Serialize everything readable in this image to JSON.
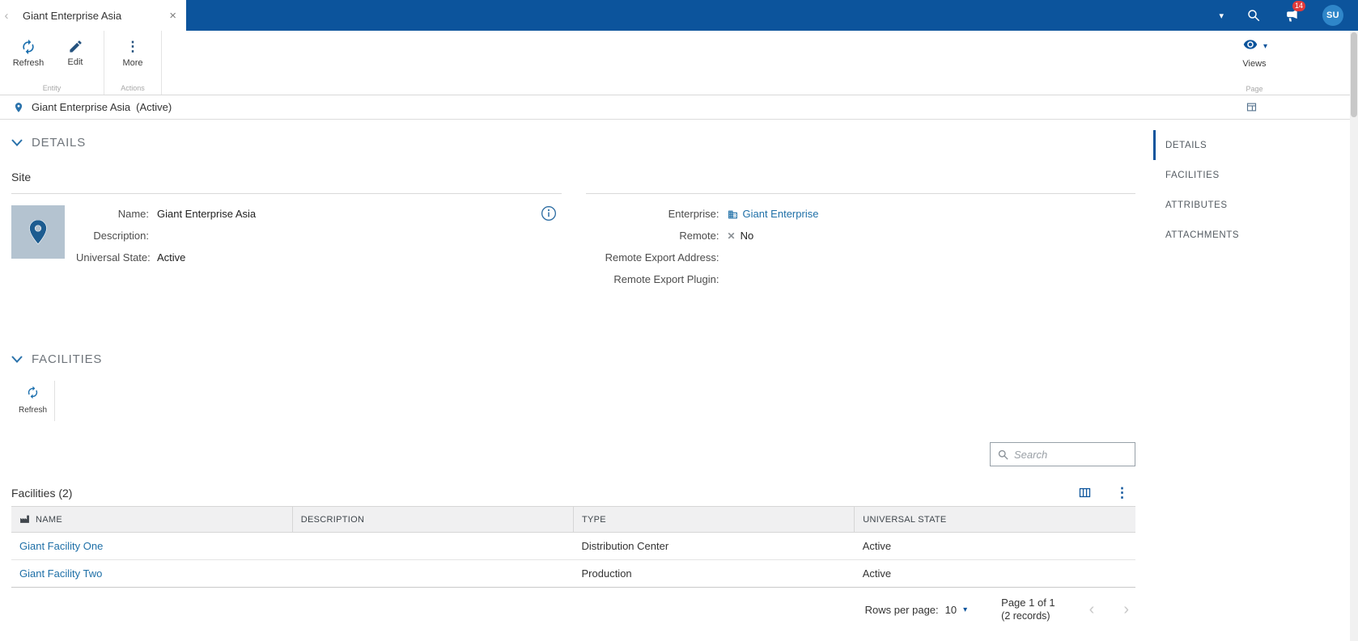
{
  "colors": {
    "topbar": "#0c549c",
    "accent": "#0c549c",
    "link": "#1e6fa7",
    "badge": "#e23b3b"
  },
  "icons": {
    "back": "‹",
    "close": "×",
    "caret_down": "▾",
    "more_dots": "⋮",
    "cross": "✕",
    "prev": "‹",
    "next": "›"
  },
  "topbar": {
    "tab_title": "Giant Enterprise Asia",
    "notification_count": "14",
    "avatar_initials": "SU"
  },
  "toolbar": {
    "refresh": "Refresh",
    "edit": "Edit",
    "more": "More",
    "entity_group": "Entity",
    "actions_group": "Actions",
    "views": "Views",
    "page_group": "Page"
  },
  "titlebar": {
    "title": "Giant Enterprise Asia",
    "state": "(Active)"
  },
  "details": {
    "header": "DETAILS",
    "subsection": "Site",
    "name_label": "Name:",
    "name_value": "Giant Enterprise Asia",
    "description_label": "Description:",
    "description_value": "",
    "universal_state_label": "Universal State:",
    "universal_state_value": "Active",
    "enterprise_label": "Enterprise:",
    "enterprise_value": "Giant Enterprise",
    "remote_label": "Remote:",
    "remote_value": "No",
    "remote_export_address_label": "Remote Export Address:",
    "remote_export_address_value": "",
    "remote_export_plugin_label": "Remote Export Plugin:",
    "remote_export_plugin_value": ""
  },
  "facilities": {
    "header": "FACILITIES",
    "refresh": "Refresh",
    "search_placeholder": "Search",
    "title": "Facilities (2)",
    "columns": {
      "name": "NAME",
      "description": "DESCRIPTION",
      "type": "TYPE",
      "universal_state": "UNIVERSAL STATE"
    },
    "rows": [
      {
        "name": "Giant Facility One",
        "description": "",
        "type": "Distribution Center",
        "universal_state": "Active"
      },
      {
        "name": "Giant Facility Two",
        "description": "",
        "type": "Production",
        "universal_state": "Active"
      }
    ],
    "pagination": {
      "rows_per_page_label": "Rows per page:",
      "rows_per_page_value": "10",
      "page_label": "Page 1 of 1",
      "records_label": "(2 records)"
    }
  },
  "side_nav": {
    "items": [
      {
        "label": "DETAILS"
      },
      {
        "label": "FACILITIES"
      },
      {
        "label": "ATTRIBUTES"
      },
      {
        "label": "ATTACHMENTS"
      }
    ]
  }
}
